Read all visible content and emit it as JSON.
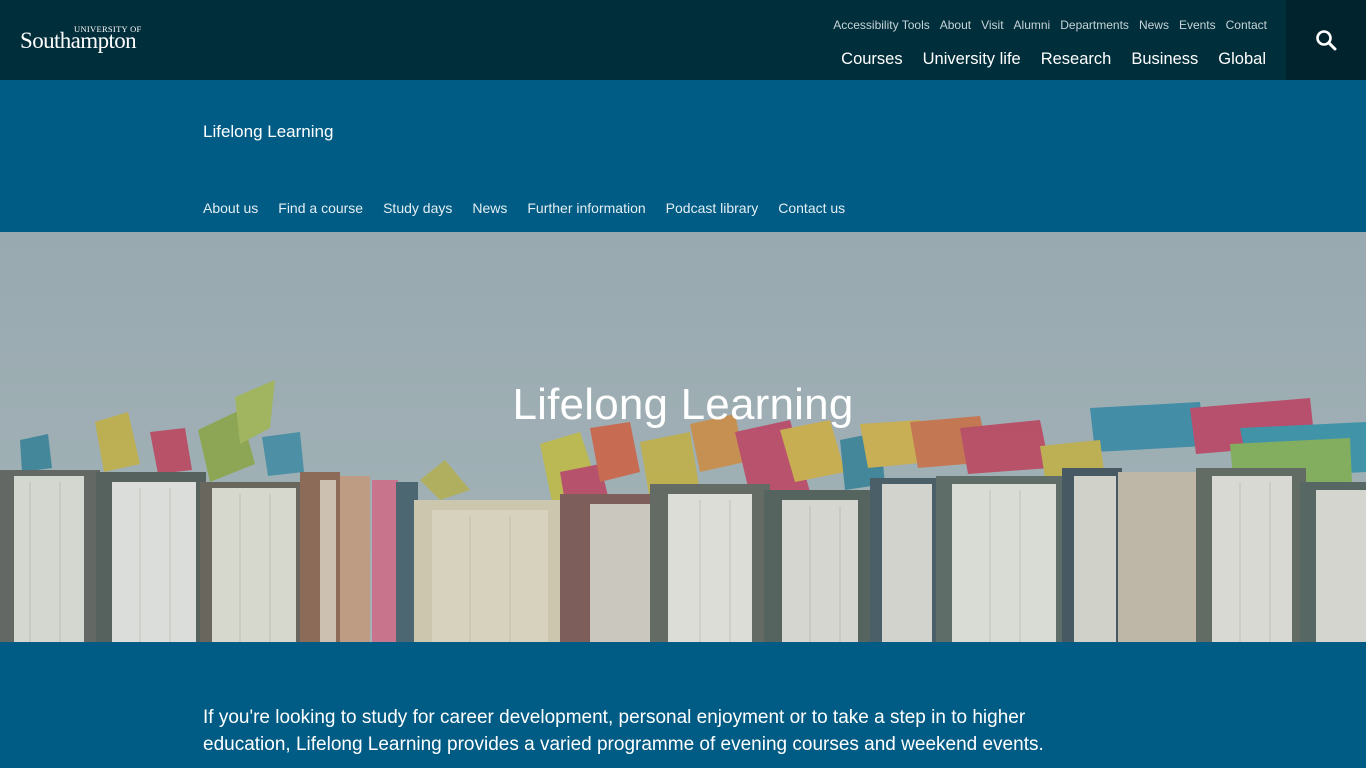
{
  "header": {
    "logo_small": "UNIVERSITY OF",
    "logo_big": "Southampton",
    "utility_links": [
      "Accessibility Tools",
      "About",
      "Visit",
      "Alumni",
      "Departments",
      "News",
      "Events",
      "Contact"
    ],
    "main_nav": [
      "Courses",
      "University life",
      "Research",
      "Business",
      "Global"
    ],
    "search_icon": "search-icon"
  },
  "section": {
    "title": "Lifelong Learning",
    "subnav": [
      "About us",
      "Find a course",
      "Study days",
      "News",
      "Further information",
      "Podcast library",
      "Contact us"
    ]
  },
  "hero": {
    "title": "Lifelong Learning"
  },
  "intro": {
    "text": "If you're looking to study for career development, personal enjoyment or to take a step in to higher education, Lifelong Learning provides a varied programme of evening courses and weekend events."
  },
  "colors": {
    "topbar": "#002e3b",
    "search_bg": "#00232d",
    "section": "#005c85",
    "hero_sky": "#9dadb3"
  }
}
